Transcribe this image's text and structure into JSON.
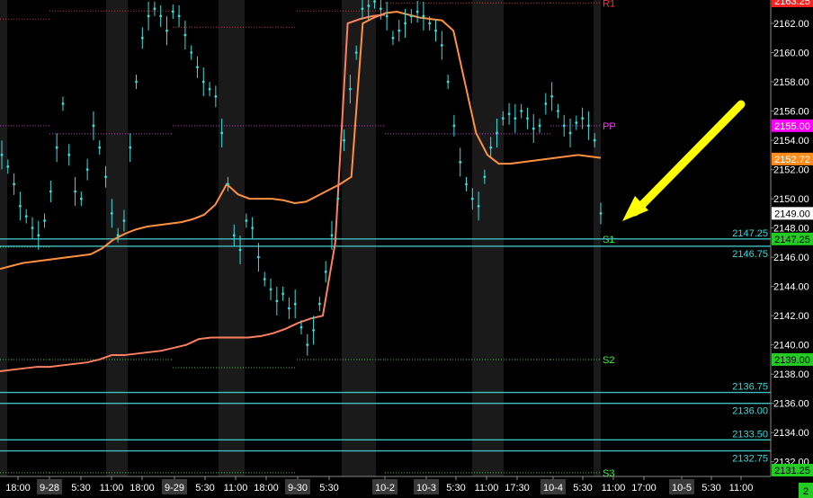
{
  "chart_data": {
    "type": "line",
    "title": "",
    "xlabel": "",
    "ylabel": "",
    "ylim": [
      2131.0,
      2163.6
    ],
    "y_ticks": [
      2132,
      2134,
      2136,
      2138,
      2140,
      2142,
      2144,
      2146,
      2148,
      2150,
      2152,
      2154,
      2156,
      2158,
      2160,
      2162
    ],
    "x_tick_labels": [
      {
        "label": "18:00",
        "highlight": false
      },
      {
        "label": "9-28",
        "highlight": true
      },
      {
        "label": "5:30",
        "highlight": false
      },
      {
        "label": "11:00",
        "highlight": false
      },
      {
        "label": "18:00",
        "highlight": false
      },
      {
        "label": "9-29",
        "highlight": true
      },
      {
        "label": "5:30",
        "highlight": false
      },
      {
        "label": "11:00",
        "highlight": false
      },
      {
        "label": "18:00",
        "highlight": false
      },
      {
        "label": "9-30",
        "highlight": true
      },
      {
        "label": "5:30",
        "highlight": false
      },
      {
        "label": "10-2",
        "highlight": true
      },
      {
        "label": "10-3",
        "highlight": true
      },
      {
        "label": "5:30",
        "highlight": false
      },
      {
        "label": "11:00",
        "highlight": false
      },
      {
        "label": "17:30",
        "highlight": false
      },
      {
        "label": "10-4",
        "highlight": true
      },
      {
        "label": "5:30",
        "highlight": false
      },
      {
        "label": "11:00",
        "highlight": false
      },
      {
        "label": "17:00",
        "highlight": false
      },
      {
        "label": "10-5",
        "highlight": true
      },
      {
        "label": "5:30",
        "highlight": false
      },
      {
        "label": "11:00",
        "highlight": false
      }
    ],
    "price_series": {
      "color": "#33e0e0",
      "values": [
        2153.0,
        2152.2,
        2151.0,
        2149.5,
        2148.8,
        2148.0,
        2147.5,
        2148.5,
        2150.5,
        2153.5,
        2156.5,
        2153.0,
        2150.5,
        2150.0,
        2152.0,
        2155.0,
        2153.5,
        2151.5,
        2149.0,
        2147.5,
        2148.5,
        2153.5,
        2158.0,
        2161.0,
        2162.5,
        2163.0,
        2162.5,
        2161.5,
        2162.8,
        2162.5,
        2161.2,
        2160.0,
        2159.0,
        2158.0,
        2157.5,
        2157.0,
        2154.5,
        2151.0,
        2147.5,
        2146.5,
        2148.5,
        2148.0,
        2146.0,
        2144.5,
        2143.8,
        2143.0,
        2143.5,
        2142.5,
        2142.8,
        2141.2,
        2140.0,
        2141.0,
        2142.8,
        2145.0,
        2147.5,
        2150.0,
        2154.0,
        2157.5,
        2160.0,
        2163.0,
        2163.2,
        2163.5,
        2163.0,
        2162.5,
        2161.0,
        2161.5,
        2162.0,
        2162.5,
        2162.8,
        2162.5,
        2162.0,
        2161.5,
        2160.5,
        2158.0,
        2155.0,
        2152.5,
        2151.0,
        2150.0,
        2149.5,
        2151.5,
        2153.5,
        2154.5,
        2155.5,
        2155.8,
        2155.5,
        2156.0,
        2155.5,
        2154.8,
        2155.0,
        2156.5,
        2157.0,
        2156.0,
        2155.0,
        2154.5,
        2155.2,
        2155.5,
        2155.0,
        2154.0,
        2149.0
      ]
    },
    "vwap_upper": {
      "color": "#ff9040",
      "values": [
        2145.2,
        2145.4,
        2145.6,
        2145.7,
        2145.8,
        2145.9,
        2146.0,
        2146.1,
        2146.2,
        2146.6,
        2147.2,
        2147.6,
        2147.9,
        2148.1,
        2148.2,
        2148.3,
        2148.4,
        2148.6,
        2148.9,
        2149.6,
        2151.0,
        2150.3,
        2150.0,
        2150.0,
        2150.0,
        2149.9,
        2149.7,
        2149.8,
        2150.2,
        2150.6,
        2151.0,
        2151.5,
        2162.0,
        2162.4,
        2162.7,
        2162.8,
        2162.6,
        2162.4,
        2162.3,
        2162.2,
        2161.5,
        2158.0,
        2154.5,
        2153.0,
        2152.4,
        2152.4,
        2152.5,
        2152.6,
        2152.7,
        2152.8,
        2152.9,
        2153.0,
        2152.9,
        2152.8
      ]
    },
    "vwap_lower": {
      "color": "#ff8060",
      "values": [
        2138.2,
        2138.3,
        2138.4,
        2138.5,
        2138.5,
        2138.6,
        2138.7,
        2138.8,
        2139.0,
        2139.3,
        2139.3,
        2139.4,
        2139.5,
        2139.6,
        2139.8,
        2140.0,
        2140.4,
        2140.5,
        2140.5,
        2140.5,
        2140.5,
        2140.6,
        2140.8,
        2141.1,
        2141.5,
        2141.8,
        2142.0,
        2147.0,
        2162.0,
        2162.3,
        2162.5,
        2162.6
      ]
    },
    "pivot_lines": [
      {
        "name": "R1",
        "value": 2163.4,
        "color": "#ff3333"
      },
      {
        "name": "PP",
        "value": 2155.0,
        "color": "#ff33ff"
      },
      {
        "name": "S1",
        "value": 2147.25,
        "color": "#33ff33"
      },
      {
        "name": "S2",
        "value": 2139.0,
        "color": "#33ff33"
      },
      {
        "name": "S3",
        "value": 2131.25,
        "color": "#33ff33"
      }
    ],
    "horizontal_levels": [
      {
        "label": "2147.25",
        "value": 2147.25
      },
      {
        "label": "2146.75",
        "value": 2146.75
      },
      {
        "label": "2136.75",
        "value": 2136.75
      },
      {
        "label": "2136.00",
        "value": 2136.0
      },
      {
        "label": "2133.50",
        "value": 2133.5
      },
      {
        "label": "2132.75",
        "value": 2132.75
      }
    ],
    "price_boxes": [
      {
        "label": "2163.25",
        "value": 2163.3,
        "bg": "#ff2020",
        "fg": "#ffffff"
      },
      {
        "label": "2155.00",
        "value": 2155.0,
        "bg": "#ff00ff",
        "fg": "#ffffff"
      },
      {
        "label": "2152.72",
        "value": 2152.72,
        "bg": "#ff8c1a",
        "fg": "#ffffff"
      },
      {
        "label": "2149.00",
        "value": 2149.0,
        "bg": "#ffffff",
        "fg": "#000000"
      },
      {
        "label": "2147.25",
        "value": 2147.25,
        "bg": "#22cc22",
        "fg": "#000000"
      },
      {
        "label": "2139.00",
        "value": 2139.0,
        "bg": "#22cc22",
        "fg": "#000000"
      },
      {
        "label": "2131.25",
        "value": 2131.25,
        "bg": "#22cc22",
        "fg": "#000000"
      }
    ],
    "corner_badge": "2",
    "annotation_arrow_color": "#ffff00",
    "colors": {
      "background": "#000000",
      "session_shade": "#1a1a1a",
      "level_line": "#40c0c0"
    }
  }
}
